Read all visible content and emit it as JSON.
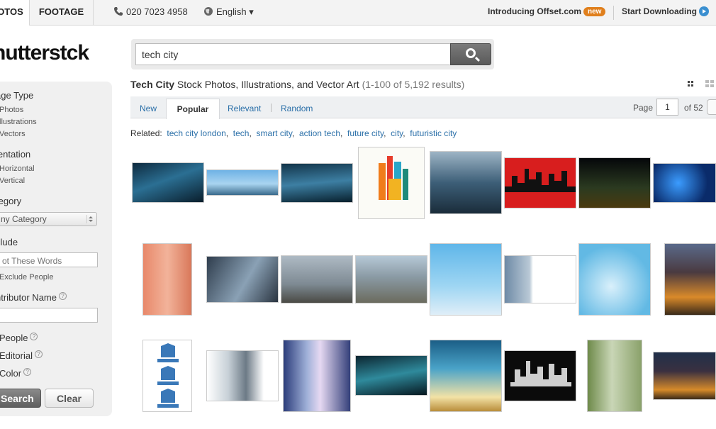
{
  "topbar": {
    "tab_photos": "OTOS",
    "tab_footage": "FOOTAGE",
    "phone": "020 7023 4958",
    "language": "English ▾",
    "offset_text": "Introducing Offset.com",
    "offset_badge": "new",
    "start_downloading": "Start Downloading"
  },
  "logo_text": "hutterstck",
  "search": {
    "value": "tech city"
  },
  "sidebar": {
    "image_type_heading": "age Type",
    "image_type_options": [
      "Photos",
      "llustrations",
      "Vectors"
    ],
    "orientation_heading": "ientation",
    "orientation_options": [
      "Horizontal",
      "Vertical"
    ],
    "category_heading": "tegory",
    "category_value": "ny Category",
    "exclude_heading": "clude",
    "exclude_placeholder": "ot These Words",
    "exclude_people": "Exclude People",
    "contributor_heading": "ntributor Name",
    "people_label": "People",
    "editorial_label": "Editorial",
    "color_label": "Color",
    "search_button": "Search",
    "clear_button": "Clear"
  },
  "results": {
    "title_bold": "Tech City",
    "title_rest": "Stock Photos, Illustrations, and Vector Art",
    "count": "(1-100 of 5,192 results)"
  },
  "sort": {
    "new": "New",
    "popular": "Popular",
    "relevant": "Relevant",
    "random": "Random",
    "page_label": "Page",
    "page_value": "1",
    "page_of": "of 52"
  },
  "related": {
    "label": "Related:",
    "terms": [
      "tech city london",
      "tech",
      "smart city",
      "action tech",
      "future city",
      "city",
      "futuristic city"
    ]
  },
  "icons": {
    "phone": "phone-icon",
    "globe": "globe-icon",
    "search": "magnifier-icon",
    "arrow": "arrow-right-icon",
    "grid_small": "grid-small-icon",
    "grid_large": "grid-large-icon",
    "help": "help-icon"
  },
  "colors": {
    "link": "#2a6fa8",
    "badge": "#e07f1c",
    "arrow_circle": "#3a8fd0"
  }
}
